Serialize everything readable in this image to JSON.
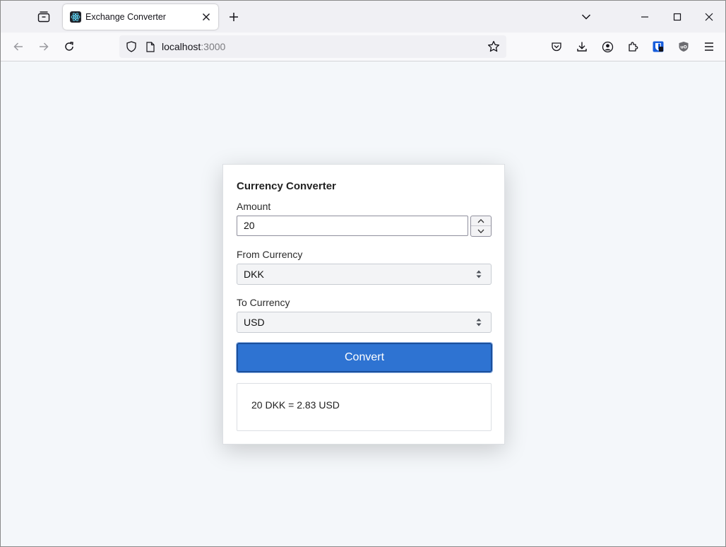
{
  "browser": {
    "tab": {
      "title": "Exchange Converter"
    },
    "url": {
      "host": "localhost",
      "port": ":3000"
    }
  },
  "converter": {
    "title": "Currency Converter",
    "amount_label": "Amount",
    "amount_value": "20",
    "from_label": "From Currency",
    "from_value": "DKK",
    "to_label": "To Currency",
    "to_value": "USD",
    "convert_label": "Convert",
    "result": "20 DKK = 2.83 USD"
  },
  "colors": {
    "accent": "#2e73d2",
    "page_bg": "#f4f7fa"
  },
  "icons": [
    "tab-list-icon",
    "react-favicon-icon",
    "close-icon",
    "plus-icon",
    "chevron-down-icon",
    "minimize-icon",
    "maximize-icon",
    "back-arrow-icon",
    "forward-arrow-icon",
    "reload-icon",
    "shield-icon",
    "page-icon",
    "star-icon",
    "pocket-icon",
    "download-icon",
    "account-icon",
    "extensions-icon",
    "bitwarden-icon",
    "ublock-icon",
    "menu-icon"
  ]
}
